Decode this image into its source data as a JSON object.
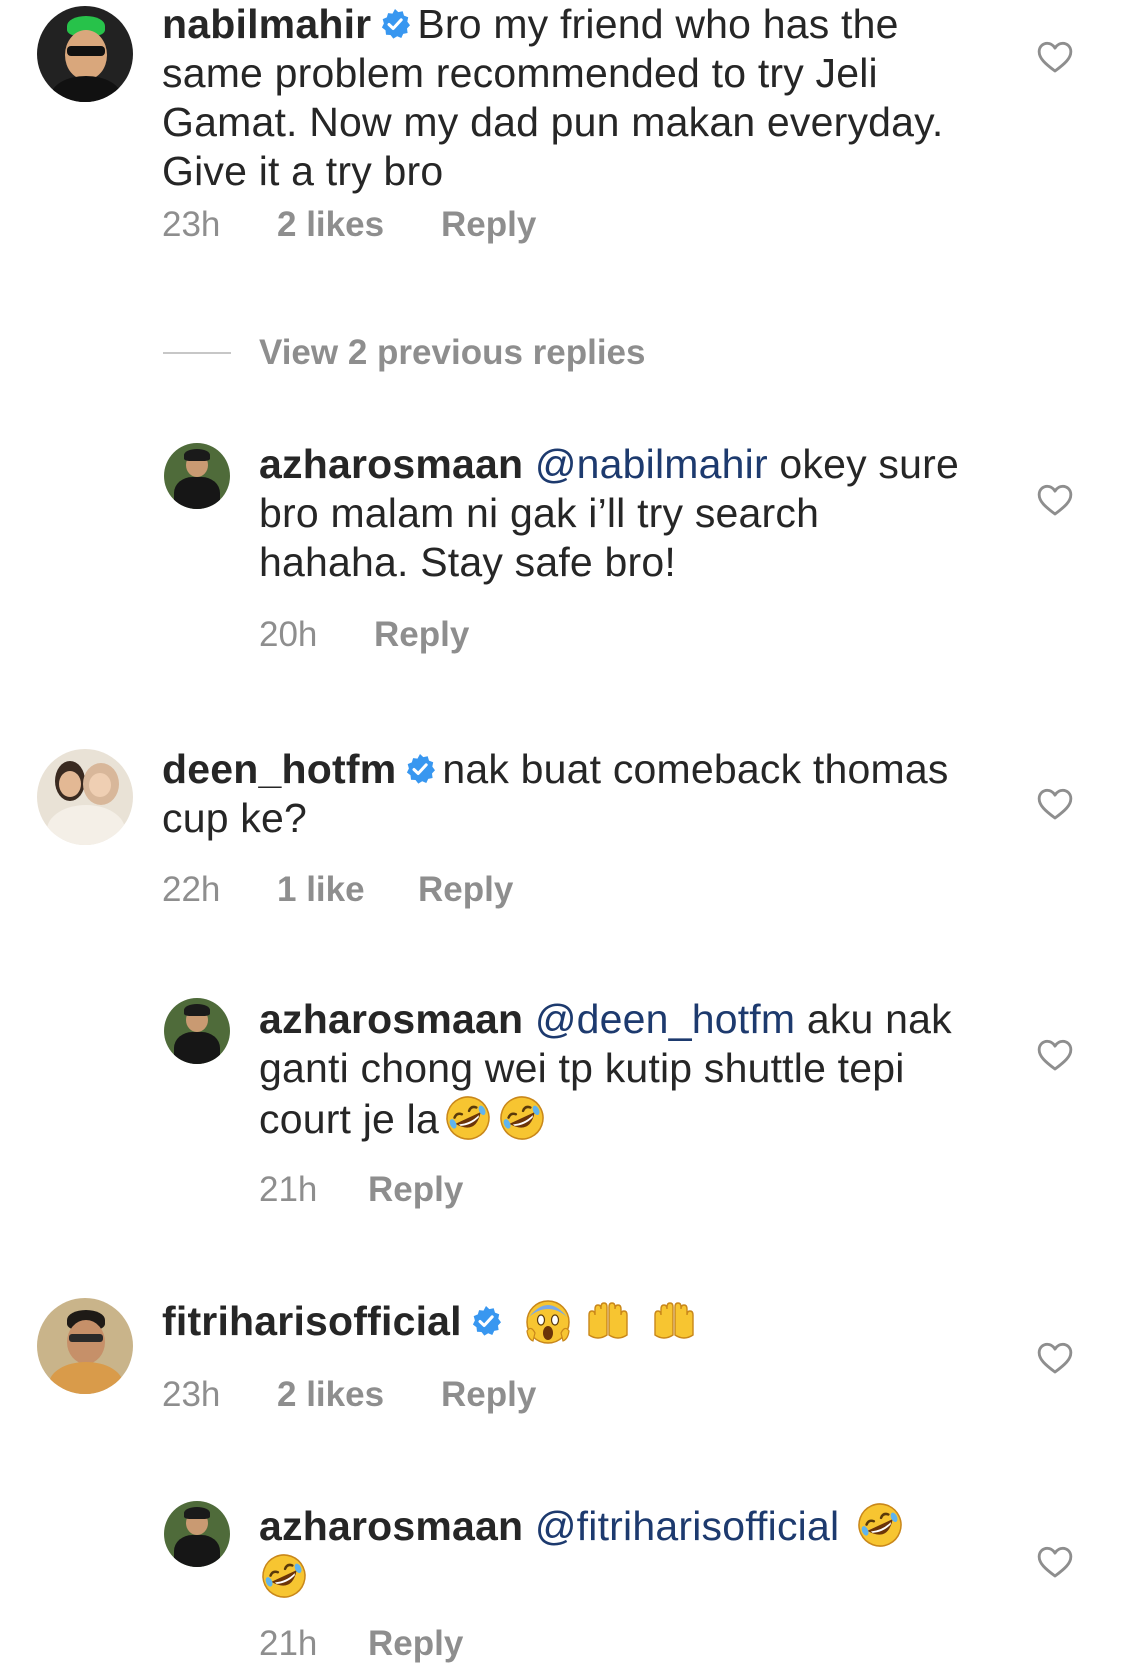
{
  "comments": [
    {
      "username": "nabilmahir",
      "verified": true,
      "text": "Bro my friend who has the same problem recommended to try Jeli Gamat. Now my dad pun makan everyday. Give it a try bro",
      "time": "23h",
      "likes": "2 likes",
      "reply_label": "Reply"
    },
    {
      "username": "azharosmaan",
      "mention": "@nabilmahir",
      "text": " okey sure bro malam ni gak i’ll try search hahaha. Stay safe bro!",
      "time": "20h",
      "reply_label": "Reply"
    },
    {
      "username": "deen_hotfm",
      "verified": true,
      "text": "nak buat comeback thomas cup ke?",
      "time": "22h",
      "likes": "1 like",
      "reply_label": "Reply"
    },
    {
      "username": "azharosmaan",
      "mention": "@deen_hotfm",
      "text": " aku nak ganti chong wei tp kutip shuttle tepi court je la",
      "emojis": [
        "rofl-emoji",
        "rofl-emoji"
      ],
      "time": "21h",
      "reply_label": "Reply"
    },
    {
      "username": "fitriharisofficial",
      "verified": true,
      "emojis": [
        "scream-emoji",
        "raised-hands-emoji",
        "raised-hands-emoji"
      ],
      "time": "23h",
      "likes": "2 likes",
      "reply_label": "Reply"
    },
    {
      "username": "azharosmaan",
      "mention": "@fitriharisofficial",
      "emojis": [
        "rofl-emoji",
        "rofl-emoji"
      ],
      "time": "21h",
      "reply_label": "Reply"
    }
  ],
  "view_previous_replies": "View 2 previous replies",
  "colors": {
    "text": "#262626",
    "meta": "#8e8e8e",
    "mention": "#1d3a6e",
    "verified": "#3897f0",
    "heart": "#8e8e8e"
  }
}
